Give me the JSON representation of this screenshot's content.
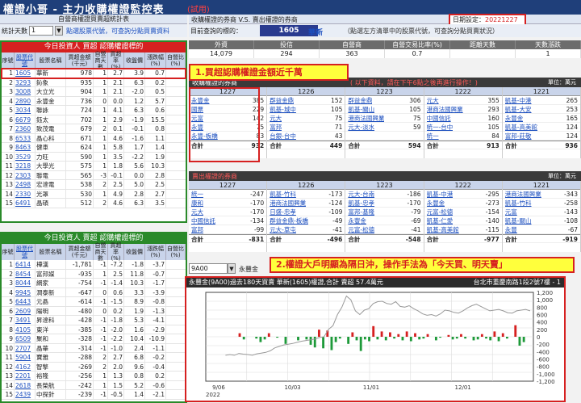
{
  "app": {
    "title": "權證小哥 - 主力收購權證監控表",
    "trial": "(試用)"
  },
  "left": {
    "subheader": "自營商權證買賣超統計表",
    "days_label": "統計天數",
    "days_value": "1",
    "days_hint": "點選股票代號，可查詢分點買賣資料",
    "buy_title": "今日投資人 買超 認購權證標的",
    "sell_title": "今日投資人 賣超 認購權證標的",
    "columns": [
      "序號",
      "股票代號",
      "股票名稱",
      "買超金額(千元)",
      "自營商天數",
      "買超率(%)",
      "收盤價",
      "漲跌幅(%)",
      "自營比(%)"
    ],
    "buy_rows": [
      [
        "1",
        "1605",
        "華新",
        "978",
        "1",
        "2.7",
        "3.9",
        "0.7"
      ],
      [
        "2",
        "3293",
        "鈊象",
        "935",
        "1",
        "2.1",
        "6.3",
        "0.2"
      ],
      [
        "3",
        "3008",
        "大立光",
        "904",
        "1",
        "2.1",
        "-2.0",
        "0.5"
      ],
      [
        "4",
        "2890",
        "永豐金",
        "736",
        "0",
        "0.0",
        "1.2",
        "5.7"
      ],
      [
        "5",
        "3034",
        "聯詠",
        "724",
        "1",
        "4.1",
        "6.3",
        "0.6"
      ],
      [
        "6",
        "6679",
        "鈺太",
        "702",
        "1",
        "2.9",
        "-1.9",
        "15.5"
      ],
      [
        "7",
        "2360",
        "致茂電",
        "679",
        "2",
        "0.1",
        "-0.1",
        "0.8"
      ],
      [
        "8",
        "6533",
        "晶心科",
        "671",
        "1",
        "4.6",
        "-1.6",
        "1.1"
      ],
      [
        "9",
        "8463",
        "健車",
        "624",
        "1",
        "5.8",
        "1.7",
        "1.4"
      ],
      [
        "10",
        "3529",
        "力旺",
        "590",
        "1",
        "3.5",
        "-2.2",
        "1.9"
      ],
      [
        "11",
        "3218",
        "大學光",
        "575",
        "1",
        "1.8",
        "5.6",
        "10.3"
      ],
      [
        "12",
        "2303",
        "聯電",
        "565",
        "-3",
        "-0.1",
        "0.0",
        "2.8"
      ],
      [
        "13",
        "2498",
        "宏達電",
        "538",
        "2",
        "2.5",
        "5.0",
        "2.5"
      ],
      [
        "14",
        "2330",
        "光罩",
        "530",
        "1",
        "4.9",
        "2.8",
        "2.7"
      ],
      [
        "15",
        "6491",
        "晶碩",
        "512",
        "2",
        "4.6",
        "6.3",
        "3.5"
      ]
    ],
    "sell_rows": [
      [
        "1",
        "6414",
        "樺漢",
        "-1,781",
        "-1",
        "-7.2",
        "-1.8",
        "-3.7"
      ],
      [
        "2",
        "8454",
        "富邦媒",
        "-935",
        "1",
        "2.5",
        "11.8",
        "-0.7"
      ],
      [
        "3",
        "8044",
        "網家",
        "-754",
        "-1",
        "-1.4",
        "10.3",
        "-1.7"
      ],
      [
        "4",
        "9945",
        "潤泰新",
        "-647",
        "0",
        "0.6",
        "3.3",
        "-3.9"
      ],
      [
        "5",
        "6443",
        "元晶",
        "-614",
        "-1",
        "-1.5",
        "8.9",
        "-0.8"
      ],
      [
        "6",
        "2609",
        "陽明",
        "-480",
        "0",
        "0.2",
        "1.9",
        "-1.3"
      ],
      [
        "7",
        "3491",
        "昇達科",
        "-428",
        "-1",
        "-1.8",
        "5.3",
        "-4.1"
      ],
      [
        "8",
        "4105",
        "東洋",
        "-385",
        "-1",
        "-2.0",
        "1.6",
        "-2.9"
      ],
      [
        "9",
        "6509",
        "聚和",
        "-328",
        "-1",
        "-2.2",
        "10.4",
        "-10.9"
      ],
      [
        "10",
        "2707",
        "晶華",
        "-314",
        "-1",
        "-1.0",
        "2.4",
        "-1.1"
      ],
      [
        "11",
        "5904",
        "寶雅",
        "-288",
        "2",
        "2.7",
        "6.8",
        "-0.2"
      ],
      [
        "12",
        "4162",
        "智擎",
        "-269",
        "2",
        "2.0",
        "9.6",
        "-0.4"
      ],
      [
        "13",
        "2201",
        "裕隆",
        "-256",
        "1",
        "1.3",
        "0.8",
        "0.2"
      ],
      [
        "14",
        "2618",
        "長榮航",
        "-242",
        "1",
        "1.5",
        "5.2",
        "-0.6"
      ],
      [
        "15",
        "2439",
        "中探針",
        "-239",
        "-1",
        "-0.5",
        "1.4",
        "-2.1"
      ]
    ]
  },
  "right": {
    "header": "收購權證的券商 V.S. 賣出權證的券商",
    "date_label": "日期設定",
    "date_value": "20221227",
    "query_label": "目前查詢的標的：",
    "query_code": "1605",
    "query_name": "華新",
    "query_hint": "（點選左方清單中的股票代號，可查詢分點買賣狀況）",
    "info_headers": [
      "外資",
      "投信",
      "自營商",
      "自營交易比率(%)",
      "距離天數",
      "天數漲跌"
    ],
    "info_values": [
      "14,079",
      "294",
      "363",
      "0.7",
      "",
      "1"
    ],
    "buy_header": "收購權證的券商",
    "buy_hint": "( 以下資料，請在下午6點之後再進行操作！)",
    "unit": "單位：萬元",
    "sell_header": "賣出權證的券商",
    "buy_blocks": [
      {
        "date": "1227",
        "rows": [
          [
            "永豐金",
            "385"
          ],
          [
            "國票",
            "229"
          ],
          [
            "元富",
            "142"
          ],
          [
            "永豐",
            "75"
          ],
          [
            "永豐-板橋",
            "83"
          ]
        ],
        "total": "932"
      },
      {
        "date": "1226",
        "rows": [
          [
            "群益金鼎",
            "152"
          ],
          [
            "凱基-城中",
            "105"
          ],
          [
            "元大",
            "75"
          ],
          [
            "富邦",
            "71"
          ],
          [
            "台銀-台中",
            "43"
          ]
        ],
        "total": "449"
      },
      {
        "date": "1223",
        "rows": [
          [
            "群益金鼎",
            "306"
          ],
          [
            "凱基-關山",
            "105"
          ],
          [
            "港商法國興業",
            "75"
          ],
          [
            "元大-淡水",
            "59"
          ],
          [
            "",
            ""
          ]
        ],
        "total": "594"
      },
      {
        "date": "1222",
        "rows": [
          [
            "元大",
            "355"
          ],
          [
            "港商法國興業",
            "293"
          ],
          [
            "中國信託",
            "160"
          ],
          [
            "統一-台中",
            "105"
          ],
          [
            "統一",
            "84"
          ]
        ],
        "total": "913"
      },
      {
        "date": "1221",
        "rows": [
          [
            "凱基-中港",
            "265"
          ],
          [
            "凱基-大安",
            "253"
          ],
          [
            "永豐金",
            "165"
          ],
          [
            "凱基-高美館",
            "124"
          ],
          [
            "富邦-莊敬",
            "124"
          ]
        ],
        "total": "936"
      }
    ],
    "sell_blocks": [
      {
        "date": "1227",
        "rows": [
          [
            "統一",
            "-247"
          ],
          [
            "康和",
            "-170"
          ],
          [
            "元大",
            "-170"
          ],
          [
            "中國信託",
            "-134"
          ],
          [
            "富邦",
            "-99"
          ]
        ],
        "total": "-831"
      },
      {
        "date": "1226",
        "rows": [
          [
            "凱基-竹科",
            "-173"
          ],
          [
            "港商法國興業",
            "-124"
          ],
          [
            "日盛-忠孝",
            "-109"
          ],
          [
            "群益金鼎-板橋",
            "-49"
          ],
          [
            "元大-草屯",
            "-41"
          ]
        ],
        "total": "-496"
      },
      {
        "date": "1223",
        "rows": [
          [
            "元大-台南",
            "-186"
          ],
          [
            "凱基-忠孝",
            "-170"
          ],
          [
            "富邦-基隆",
            "-79"
          ],
          [
            "永豐金",
            "-69"
          ],
          [
            "元富-松德",
            "-41"
          ]
        ],
        "total": "-548"
      },
      {
        "date": "1222",
        "rows": [
          [
            "凱基-中港",
            "-295"
          ],
          [
            "永豐金",
            "-273"
          ],
          [
            "元富-松德",
            "-154"
          ],
          [
            "凱基-仁愛",
            "-140"
          ],
          [
            "凱基-高美館",
            "-115"
          ]
        ],
        "total": "-977"
      },
      {
        "date": "1221",
        "rows": [
          [
            "港商法國興業",
            "-343"
          ],
          [
            "凱基-竹科",
            "-258"
          ],
          [
            "元富",
            "-143"
          ],
          [
            "凱基-關山",
            "-108"
          ],
          [
            "永豐",
            "-67"
          ]
        ],
        "total": "-919"
      }
    ],
    "chart_symbol": "9A00",
    "chart_symbol_name": "永豐金",
    "annotation1": "1.買超認購權證金額近千萬",
    "annotation2": "2.權證大戶明顯為隔日沖，操作手法為「今天買、明天賣」",
    "chart_title": "永豐金(9A00)過去180天買賣 華新(1605)權證,合計 賣超 57.4萬元",
    "chart_address": "台北市重慶南路1段2號7樓 - 1"
  },
  "chart_data": {
    "type": "bar",
    "title": "永豐金(9A00)過去180天買賣 華新(1605)權證,合計 賣超 57.4萬元",
    "xticks": [
      "9/06",
      "10/03",
      "11/01",
      "12/01"
    ],
    "xtick_year": "2022",
    "y_left": {
      "range": [
        -500,
        500
      ],
      "ticks": [
        "500",
        "400",
        "300",
        "200",
        "100",
        "0",
        "-100",
        "-200",
        "-300",
        "-400",
        "-500"
      ]
    },
    "y_right": {
      "range": [
        -1200,
        1200
      ],
      "ticks": [
        "1,200",
        "1,000",
        "800",
        "600",
        "400",
        "200",
        "0",
        "-200",
        "-400",
        "-600",
        "-800",
        "-1,000",
        "-1,200"
      ]
    },
    "series": [
      {
        "values": [
          40,
          -30,
          0,
          0,
          -20,
          -60,
          -30,
          40,
          0,
          -10,
          0,
          -80,
          0,
          0,
          -40,
          0,
          -30,
          -90,
          -120,
          80,
          -130,
          70,
          -150,
          -60,
          -20,
          0,
          -80,
          50,
          -40,
          -160,
          -30,
          -50,
          120,
          -30,
          60,
          -40,
          50,
          -20,
          30,
          -40,
          60,
          -50,
          40,
          -30,
          -20,
          30,
          0,
          -40,
          -10,
          0,
          20,
          -30,
          -20,
          30,
          -20,
          0,
          -40,
          -30,
          30,
          -20,
          -40,
          60,
          -50,
          40,
          -20,
          0,
          130,
          -100,
          -60
        ]
      },
      {
        "values": [
          -500,
          -480,
          -500,
          -450,
          -470,
          -480,
          -500,
          -460,
          -440,
          -420,
          -380,
          -300,
          -260,
          -220,
          -200,
          -180,
          -150,
          -120,
          -100,
          -80,
          -60,
          -20,
          0,
          200,
          300,
          600,
          800,
          1100,
          1000,
          700,
          600,
          720,
          760,
          900,
          950,
          960,
          900,
          880,
          950,
          820,
          800,
          840,
          760,
          700,
          620,
          580,
          600,
          560,
          620,
          720,
          700,
          660,
          640,
          700,
          780,
          840,
          880,
          820,
          760,
          700,
          720,
          740,
          700,
          650,
          640,
          700,
          720,
          740,
          700
        ]
      }
    ]
  }
}
